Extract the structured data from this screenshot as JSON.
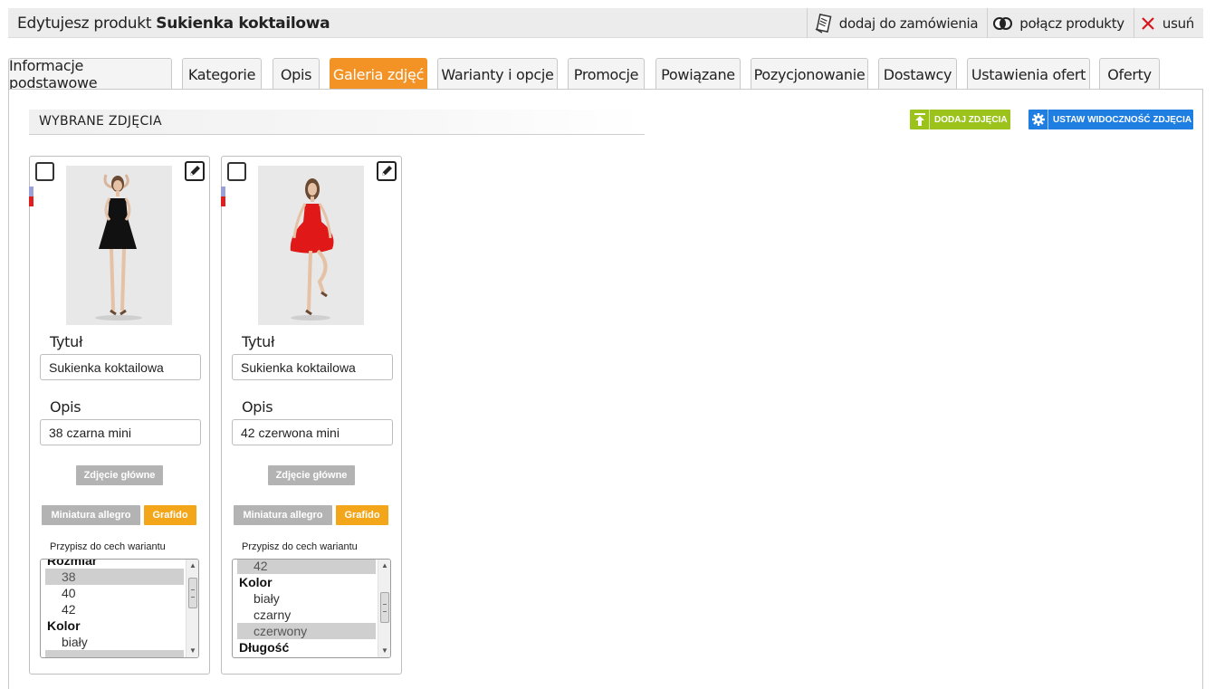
{
  "header": {
    "title_prefix": "Edytujesz produkt ",
    "title_product": "Sukienka koktailowa",
    "actions": {
      "add_to_order": "dodaj do zamówienia",
      "merge_products": "połącz produkty",
      "delete": "usuń"
    }
  },
  "tabs": [
    {
      "label": "Informacje podstawowe",
      "active": false
    },
    {
      "label": "Kategorie",
      "active": false
    },
    {
      "label": "Opis",
      "active": false
    },
    {
      "label": "Galeria zdjęć",
      "active": true
    },
    {
      "label": "Warianty i opcje",
      "active": false
    },
    {
      "label": "Promocje",
      "active": false
    },
    {
      "label": "Powiązane",
      "active": false
    },
    {
      "label": "Pozycjonowanie",
      "active": false
    },
    {
      "label": "Dostawcy",
      "active": false
    },
    {
      "label": "Ustawienia ofert",
      "active": false
    },
    {
      "label": "Oferty",
      "active": false
    }
  ],
  "section": {
    "title": "WYBRANE ZDJĘCIA",
    "add_photos": "DODAJ ZDJĘCIA",
    "set_visibility": "USTAW WIDOCZNOŚĆ ZDJĘCIA"
  },
  "colors": {
    "accent_orange": "#f39325",
    "green": "#9bc31c",
    "blue": "#1e7ee1"
  },
  "cards": [
    {
      "title_label": "Tytuł",
      "title_value": "Sukienka koktailowa",
      "desc_label": "Opis",
      "desc_value": "38 czarna mini",
      "main_photo": "Zdjęcie główne",
      "allegro": "Miniatura allegro",
      "grafido": "Grafido",
      "assign_label": "Przypisz do cech wariantu",
      "dress_color": "#111111",
      "list": {
        "g0": "Rozmiar",
        "r0": "38",
        "r1": "40",
        "r2": "42",
        "g1": "Kolor",
        "r3": "biały"
      }
    },
    {
      "title_label": "Tytuł",
      "title_value": "Sukienka koktailowa",
      "desc_label": "Opis",
      "desc_value": "42 czerwona mini",
      "main_photo": "Zdjęcie główne",
      "allegro": "Miniatura allegro",
      "grafido": "Grafido",
      "assign_label": "Przypisz do cech wariantu",
      "dress_color": "#e01818",
      "list": {
        "r0": "42",
        "g0": "Kolor",
        "r1": "biały",
        "r2": "czarny",
        "r3": "czerwony",
        "g1": "Długość"
      }
    }
  ]
}
